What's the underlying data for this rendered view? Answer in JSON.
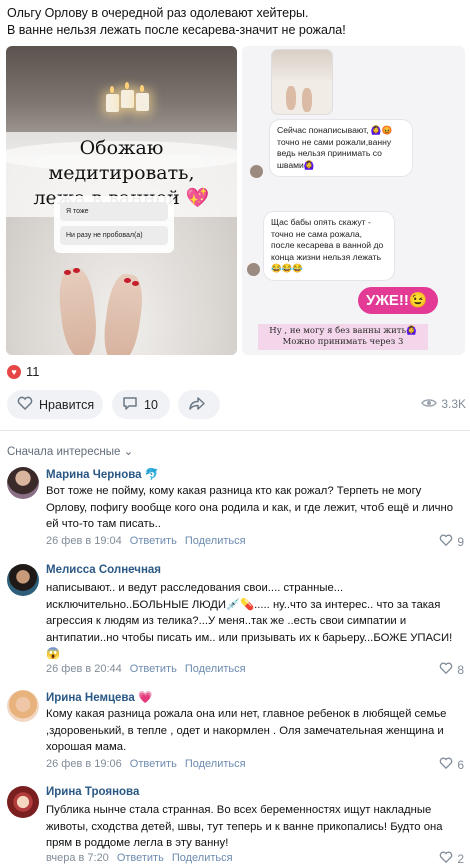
{
  "post": {
    "line1": "Ольгу Орлову в очередной раз одолевают хейтеры.",
    "line2": "В ванне нельзя лежать после кесарева-значит не рожала!"
  },
  "image_left": {
    "title_line1": "Обожаю медитировать,",
    "title_line2": "лежа в ванной",
    "poll_option1": "Я тоже",
    "poll_option2": "Ни разу не пробовал(а)"
  },
  "image_right": {
    "bubble1": "Сейчас понаписывают, 🙆‍♀️😡 точно не сами рожали,ванну ведь нельзя принимать со швами🙆‍♀️",
    "bubble2": "Щас бабы опять скажут - точно не сама рожала, после кесарева в ванной до конца жизни нельзя лежать 😂😂😂",
    "badge": "УЖЕ!!😉",
    "note_line1": "Ну , не могу я без ванны жить🙆‍♀️",
    "note_line2": "Можно принимать через 3"
  },
  "reactions": {
    "likes": "11",
    "like_label": "Нравится",
    "comments": "10",
    "views": "3.3K"
  },
  "sort_label": "Сначала интересные",
  "comments": [
    {
      "author": "Марина Чернова",
      "author_emoji": "🐬",
      "text": "Вот тоже не пойму, кому какая разница кто как рожал? Терпеть не могу Орлову, пофигу вообще кого она родила и как, и где лежит, чтоб ещё и лично ей что-то там писать..",
      "date": "26 фев в 19:04",
      "reply": "Ответить",
      "share": "Поделиться",
      "likes": "9"
    },
    {
      "author": "Мелисса Солнечная",
      "author_emoji": "",
      "text": "написывают.. и ведут расследования свои.... странные... исключительно..БОЛЬНЫЕ ЛЮДИ💉💊..... ну..что за интерес.. что за такая агрессия к людям из телика?...У меня..так же ..есть свои симпатии и антипатии..но чтобы писать им.. или призывать их к барьеру...БОЖЕ УПАСИ!😱",
      "date": "26 фев в 20:44",
      "reply": "Ответить",
      "share": "Поделиться",
      "likes": "8"
    },
    {
      "author": "Ирина Немцева",
      "author_emoji": "💗",
      "text": "Кому какая разница рожала она или нет, главное ребенок в любящей семье ,здоровенький, в тепле , одет и накормлен . Оля замечательная женщина и хорошая мама.",
      "date": "26 фев в 19:06",
      "reply": "Ответить",
      "share": "Поделиться",
      "likes": "6"
    },
    {
      "author": "Ирина Троянова",
      "author_emoji": "",
      "text": "Публика нынче стала странная. Во всех беременностях ищут накладные животы, сходства детей, швы, тут теперь и к ванне прикопались! Будто она прям в роддоме легла в эту ванну!",
      "date": "вчера в 7:20",
      "reply": "Ответить",
      "share": "Поделиться",
      "likes": "2"
    }
  ],
  "colors": {
    "link": "#2a5885",
    "muted": "#818c99",
    "like_red": "#e64646",
    "badge_pink": "#e23a95"
  }
}
